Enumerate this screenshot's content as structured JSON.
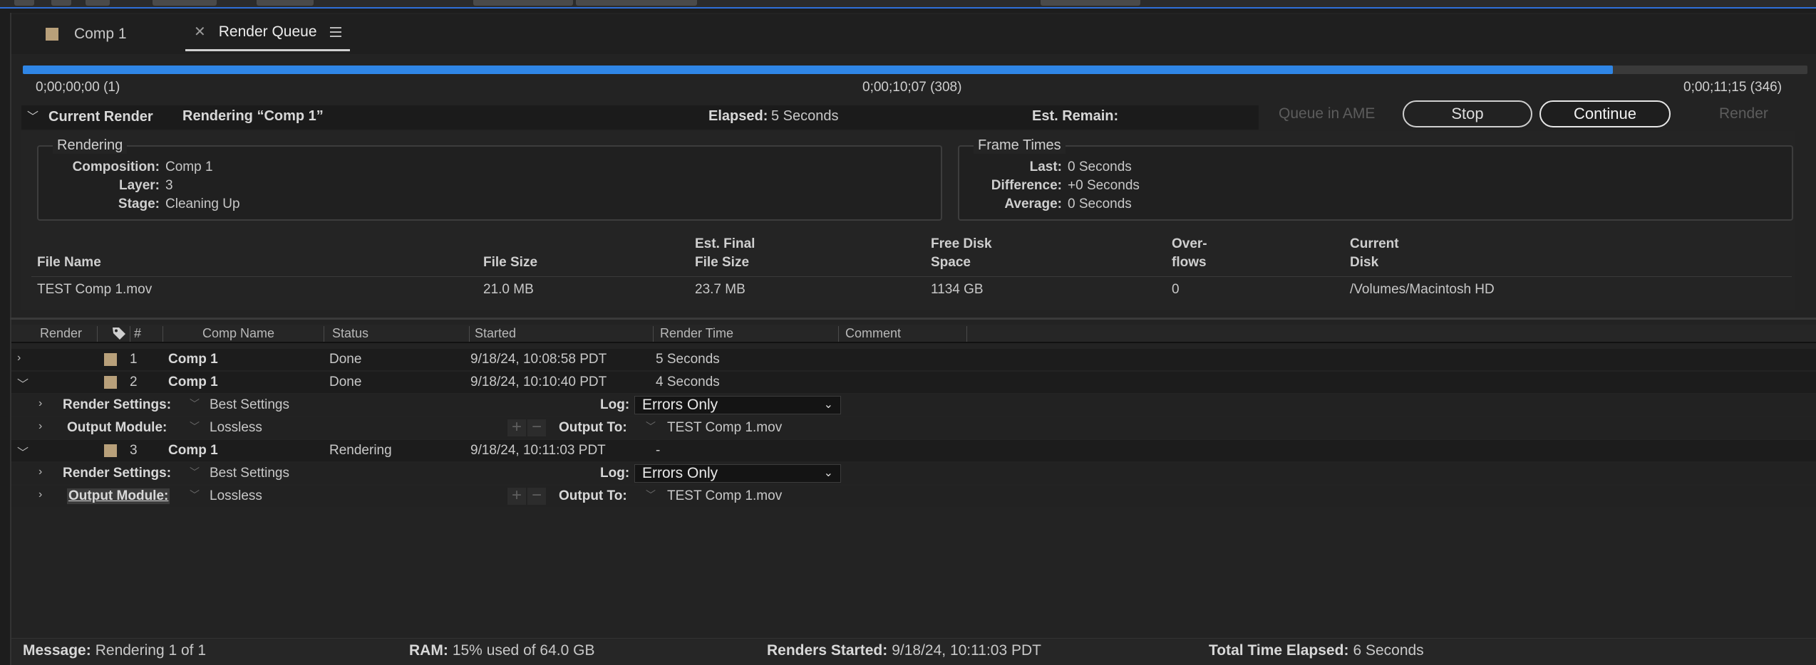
{
  "tabs": [
    {
      "label": "Comp 1"
    },
    {
      "label": "Render Queue"
    }
  ],
  "progress": {
    "fraction": 0.891,
    "start": "0;00;00;00 (1)",
    "current": "0;00;10;07 (308)",
    "end": "0;00;11;15 (346)"
  },
  "current_render": {
    "label": "Current Render",
    "rendering_text": "Rendering “Comp 1”",
    "elapsed_label": "Elapsed:",
    "elapsed_value": "5 Seconds",
    "remain_label": "Est. Remain:",
    "remain_value": ""
  },
  "buttons": {
    "queue_ame": "Queue in AME",
    "stop": "Stop",
    "continue": "Continue",
    "render": "Render"
  },
  "rendering_group": {
    "title": "Rendering",
    "composition_label": "Composition:",
    "composition": "Comp 1",
    "layer_label": "Layer:",
    "layer": "3",
    "stage_label": "Stage:",
    "stage": "Cleaning Up"
  },
  "frame_times": {
    "title": "Frame Times",
    "last_label": "Last:",
    "last": "0 Seconds",
    "difference_label": "Difference:",
    "difference": "+0 Seconds",
    "average_label": "Average:",
    "average": "0 Seconds"
  },
  "file_info": {
    "headers": {
      "file_name": "File Name",
      "file_size": "File Size",
      "est_final_1": "Est. Final",
      "est_final_2": "File Size",
      "free_disk_1": "Free Disk",
      "free_disk_2": "Space",
      "overflows_1": "Over-",
      "overflows_2": "flows",
      "current_disk_1": "Current",
      "current_disk_2": "Disk"
    },
    "values": {
      "file_name": "TEST Comp 1.mov",
      "file_size": "21.0 MB",
      "est_final": "23.7 MB",
      "free_disk": "1134 GB",
      "overflows": "0",
      "current_disk": "/Volumes/Macintosh HD"
    }
  },
  "table": {
    "headers": {
      "render": "Render",
      "num": "#",
      "comp_name": "Comp Name",
      "status": "Status",
      "started": "Started",
      "render_time": "Render Time",
      "comment": "Comment"
    },
    "items": [
      {
        "num": "1",
        "comp": "Comp 1",
        "status": "Done",
        "started": "9/18/24, 10:08:58 PDT",
        "render_time": "5 Seconds"
      },
      {
        "num": "2",
        "comp": "Comp 1",
        "status": "Done",
        "started": "9/18/24, 10:10:40 PDT",
        "render_time": "4 Seconds"
      },
      {
        "num": "3",
        "comp": "Comp 1",
        "status": "Rendering",
        "started": "9/18/24, 10:11:03 PDT",
        "render_time": "-"
      }
    ],
    "sub": {
      "render_settings_label": "Render Settings:",
      "render_settings_value": "Best Settings",
      "output_module_label": "Output Module:",
      "output_module_value": "Lossless",
      "log_label": "Log:",
      "log_value": "Errors Only",
      "output_to_label": "Output To:",
      "output_to_value": "TEST Comp 1.mov"
    }
  },
  "status_bar": {
    "message_label": "Message:",
    "message": "Rendering 1 of 1",
    "ram_label": "RAM:",
    "ram": "15% used of 64.0 GB",
    "renders_started_label": "Renders Started:",
    "renders_started": "9/18/24, 10:11:03 PDT",
    "total_label": "Total Time Elapsed:",
    "total": "6 Seconds"
  },
  "colors": {
    "accent": "#2f86e6",
    "comp_swatch": "#b8a07a",
    "background": "#232323"
  }
}
